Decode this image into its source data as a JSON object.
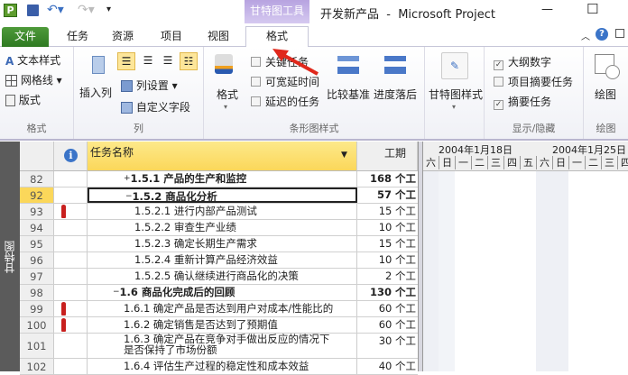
{
  "titlebar": {
    "contextual_group": "甘特图工具",
    "doc_title": "开发新产品  -  Microsoft Project",
    "minimize": "—",
    "maximize": "☐"
  },
  "tabs": [
    {
      "label": "文件"
    },
    {
      "label": "任务"
    },
    {
      "label": "资源"
    },
    {
      "label": "项目"
    },
    {
      "label": "视图"
    },
    {
      "label": "格式"
    }
  ],
  "ribbon": {
    "format_group": {
      "label": "格式",
      "items": [
        "文本样式",
        "网格线",
        "版式"
      ]
    },
    "column_group": {
      "label": "列",
      "insert_column": "插入列",
      "column_settings": "列设置",
      "custom_fields": "自定义字段"
    },
    "bar_styles_group": {
      "label": "条形图样式",
      "format": "格式",
      "checkboxes": [
        {
          "label": "关键任务",
          "checked": false
        },
        {
          "label": "可宽延时间",
          "checked": false
        },
        {
          "label": "延迟的任务",
          "checked": false
        }
      ],
      "baseline": "比较基准",
      "slippage": "进度落后"
    },
    "gantt_style_group": {
      "label": "甘特图样式"
    },
    "show_hide_group": {
      "label": "显示/隐藏",
      "checkboxes": [
        {
          "label": "大纲数字",
          "checked": true
        },
        {
          "label": "项目摘要任务",
          "checked": false
        },
        {
          "label": "摘要任务",
          "checked": true
        }
      ]
    },
    "drawing_group": {
      "label": "绘图",
      "drawing": "绘图"
    }
  },
  "view": {
    "sidebar_label": "甘特图",
    "headers": {
      "info": "i",
      "task_name": "任务名称",
      "duration": "工期"
    },
    "timescale": {
      "weeks": [
        "2004年1月18日",
        "2004年1月25日"
      ],
      "days": [
        "六",
        "日",
        "一",
        "二",
        "三",
        "四",
        "五",
        "六",
        "日",
        "一",
        "二",
        "三",
        "四"
      ]
    },
    "rows": [
      {
        "id": "82",
        "name": "1.5.1  产品的生产和监控",
        "duration": "168 个工",
        "bold": true,
        "expander": "+",
        "indent": 2,
        "person": false
      },
      {
        "id": "92",
        "name": "1.5.2  商品化分析",
        "duration": "57 个工",
        "bold": true,
        "expander": "−",
        "indent": 2,
        "person": false,
        "selected": true
      },
      {
        "id": "93",
        "name": "1.5.2.1 进行内部产品测试",
        "duration": "15 个工",
        "indent": 3,
        "person": true
      },
      {
        "id": "94",
        "name": "1.5.2.2 审查生产业绩",
        "duration": "10 个工",
        "indent": 3,
        "person": false
      },
      {
        "id": "95",
        "name": "1.5.2.3 确定长期生产需求",
        "duration": "15 个工",
        "indent": 3,
        "person": false
      },
      {
        "id": "96",
        "name": "1.5.2.4 重新计算产品经济效益",
        "duration": "10 个工",
        "indent": 3,
        "person": false
      },
      {
        "id": "97",
        "name": "1.5.2.5 确认继续进行商品化的决策",
        "duration": "2 个工",
        "indent": 3,
        "person": false
      },
      {
        "id": "98",
        "name": "1.6  商品化完成后的回顾",
        "duration": "130 个工",
        "bold": true,
        "expander": "−",
        "indent": 1,
        "person": false
      },
      {
        "id": "99",
        "name": "1.6.1 确定产品是否达到用户对成本/性能比的",
        "duration": "60 个工",
        "indent": 2,
        "person": true
      },
      {
        "id": "100",
        "name": "1.6.2 确定销售是否达到了预期值",
        "duration": "60 个工",
        "indent": 2,
        "person": true
      },
      {
        "id": "101",
        "name": "1.6.3 确定产品在竞争对手做出反应的情况下",
        "name2": "是否保持了市场份额",
        "duration": "30 个工",
        "indent": 2,
        "person": false,
        "tall": true
      },
      {
        "id": "102",
        "name": "1.6.4 评估生产过程的稳定性和成本效益",
        "duration": "40 个工",
        "indent": 2,
        "person": false
      }
    ]
  }
}
